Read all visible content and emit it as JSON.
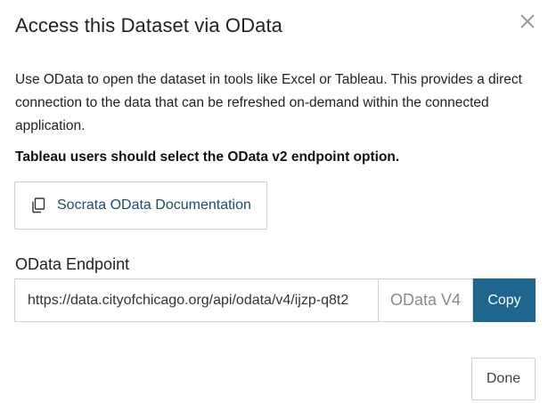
{
  "dialog": {
    "title": "Access this Dataset via OData",
    "close_icon": "close-icon",
    "description": "Use OData to open the dataset in tools like Excel or Tableau. This provides a direct connection to the data that can be refreshed on-demand within the connected application.",
    "tableau_note": "Tableau users should select the OData v2 endpoint option.",
    "doc_button": {
      "label": "Socrata OData Documentation",
      "icon": "copy-document-icon"
    },
    "endpoint": {
      "label": "OData Endpoint",
      "value": "https://data.cityofchicago.org/api/odata/v4/ijzp-q8t2",
      "version": "OData V4",
      "copy_label": "Copy"
    },
    "done_label": "Done"
  },
  "colors": {
    "accent": "#1e6590",
    "link": "#1d4d6b",
    "border": "#cfcfcf"
  }
}
